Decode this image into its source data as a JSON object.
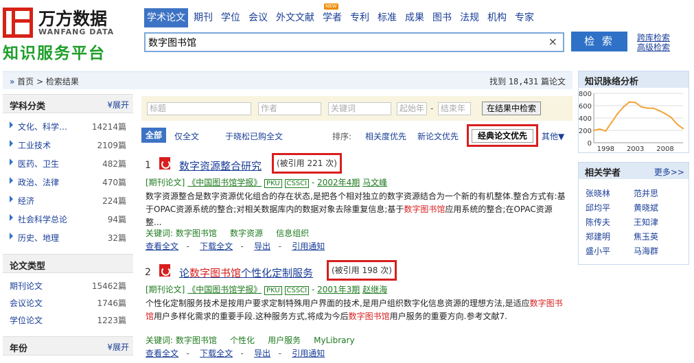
{
  "logo": {
    "cn": "万方数据",
    "en": "WANFANG DATA",
    "slogan": "知识服务平台"
  },
  "nav": [
    {
      "label": "学术论文",
      "active": true
    },
    {
      "label": "期刊"
    },
    {
      "label": "学位"
    },
    {
      "label": "会议"
    },
    {
      "label": "外文文献"
    },
    {
      "label": "学者",
      "badge": "NEW"
    },
    {
      "label": "专利"
    },
    {
      "label": "标准"
    },
    {
      "label": "成果"
    },
    {
      "label": "图书"
    },
    {
      "label": "法规"
    },
    {
      "label": "机构"
    },
    {
      "label": "专家"
    }
  ],
  "search": {
    "value": "数字图书馆",
    "clear": "×",
    "button": "检 索",
    "cross": "跨库检索",
    "advanced": "高级检索"
  },
  "breadcrumb": {
    "home": "首页",
    "current": "检索结果",
    "found_prefix": "找到",
    "found_count": "18,431",
    "found_suffix": "篇论文"
  },
  "sidebar": {
    "subject": {
      "title": "学科分类",
      "expand": "展开",
      "items": [
        {
          "name": "文化、科学…",
          "count": "14214篇"
        },
        {
          "name": "工业技术",
          "count": "2109篇"
        },
        {
          "name": "医药、卫生",
          "count": "482篇"
        },
        {
          "name": "政治、法律",
          "count": "470篇"
        },
        {
          "name": "经济",
          "count": "224篇"
        },
        {
          "name": "社会科学总论",
          "count": "94篇"
        },
        {
          "name": "历史、地理",
          "count": "32篇"
        }
      ]
    },
    "doctype": {
      "title": "论文类型",
      "items": [
        {
          "name": "期刊论文",
          "count": "15462篇"
        },
        {
          "name": "会议论文",
          "count": "1746篇"
        },
        {
          "name": "学位论文",
          "count": "1223篇"
        }
      ]
    },
    "year": {
      "title": "年份",
      "expand": "展开"
    }
  },
  "filters": {
    "title": "标题",
    "author": "作者",
    "keyword": "关键词",
    "start_year": "起始年",
    "end_year": "结束年",
    "dash": "-",
    "button": "在结果中检索"
  },
  "tabs": {
    "all": "全部",
    "fulltext": "仅全文",
    "purchased": "于晓松已购全文"
  },
  "sort": {
    "label": "排序:",
    "relevance": "相关度优先",
    "newest": "新论文优先",
    "classic": "经典论文优先",
    "more": "其他▼"
  },
  "results": [
    {
      "num": "1",
      "title": "数字资源整合研究",
      "cite": "(被引用 221 次)",
      "type": "[期刊论文]",
      "journal": "《中国图书馆学报》",
      "tag1": "PKU",
      "tag2": "CSSCI",
      "sep": "-",
      "issue": "2002年4期",
      "author": "马文峰",
      "abs1": "数字资源整合是数字资源优化组合的存在状态,是把各个相对独立的数字资源结合为一个新的有机整体.整合方式有:基于OPAC资源系统的整合;对相关数据库内的数据对象去除重复信息;基于",
      "abs_hl": "数字图书馆",
      "abs2": "应用系统的整合;在OPAC资源整...",
      "kw_label": "关键词:",
      "keywords": [
        "数字图书馆",
        "数字资源",
        "信息组织"
      ],
      "actions": [
        "查看全文",
        "下载全文",
        "导出",
        "引用通知"
      ],
      "act_sep": "-"
    },
    {
      "num": "2",
      "title_pre": "论",
      "title_hl": "数字图书馆",
      "title_post": "个性化定制服务",
      "cite": "(被引用 198 次)",
      "type": "[期刊论文]",
      "journal": "《中国图书馆学报》",
      "tag1": "PKU",
      "tag2": "CSSCI",
      "sep": "-",
      "issue": "2001年3期",
      "author": "赵继海",
      "abs1": "个性化定制服务技术是按用户要求定制特殊用户界面的技术,是用户组织数字化信息资源的理想方法,是适应",
      "abs_hl": "数字图书馆",
      "abs2": "用户多样化需求的重要手段.这种服务方式,将成为今后",
      "abs_hl2": "数字图书馆",
      "abs3": "用户服务的重要方向.参考文献7.",
      "kw_label": "关键词:",
      "keywords": [
        "数字图书馆",
        "个性化",
        "用户服务",
        "MyLibrary"
      ],
      "actions": [
        "查看全文",
        "下载全文",
        "导出",
        "引用通知"
      ],
      "act_sep": "-"
    }
  ],
  "right": {
    "trend": {
      "title": "知识脉络分析",
      "y_ticks": [
        "800",
        "600",
        "400",
        "200",
        "0"
      ],
      "x_ticks": [
        "1998",
        "2003",
        "2008"
      ]
    },
    "scholars": {
      "title": "相关学者",
      "more": "更多>>",
      "names": [
        "张晓林",
        "范并思",
        "邱均平",
        "黄晓斌",
        "陈传夫",
        "王知津",
        "郑建明",
        "焦玉英",
        "盛小平",
        "马海群"
      ]
    }
  },
  "chart_data": {
    "type": "line",
    "title": "知识脉络分析",
    "x": [
      1996,
      1997,
      1998,
      1999,
      2000,
      2001,
      2002,
      2003,
      2004,
      2005,
      2006,
      2007,
      2008,
      2009,
      2010,
      2011
    ],
    "values": [
      200,
      220,
      190,
      330,
      470,
      580,
      660,
      650,
      580,
      560,
      560,
      520,
      470,
      410,
      300,
      230
    ],
    "ylim": [
      0,
      800
    ],
    "xlabel": "",
    "ylabel": "",
    "line_color": "#f3a33a",
    "grid": true
  }
}
